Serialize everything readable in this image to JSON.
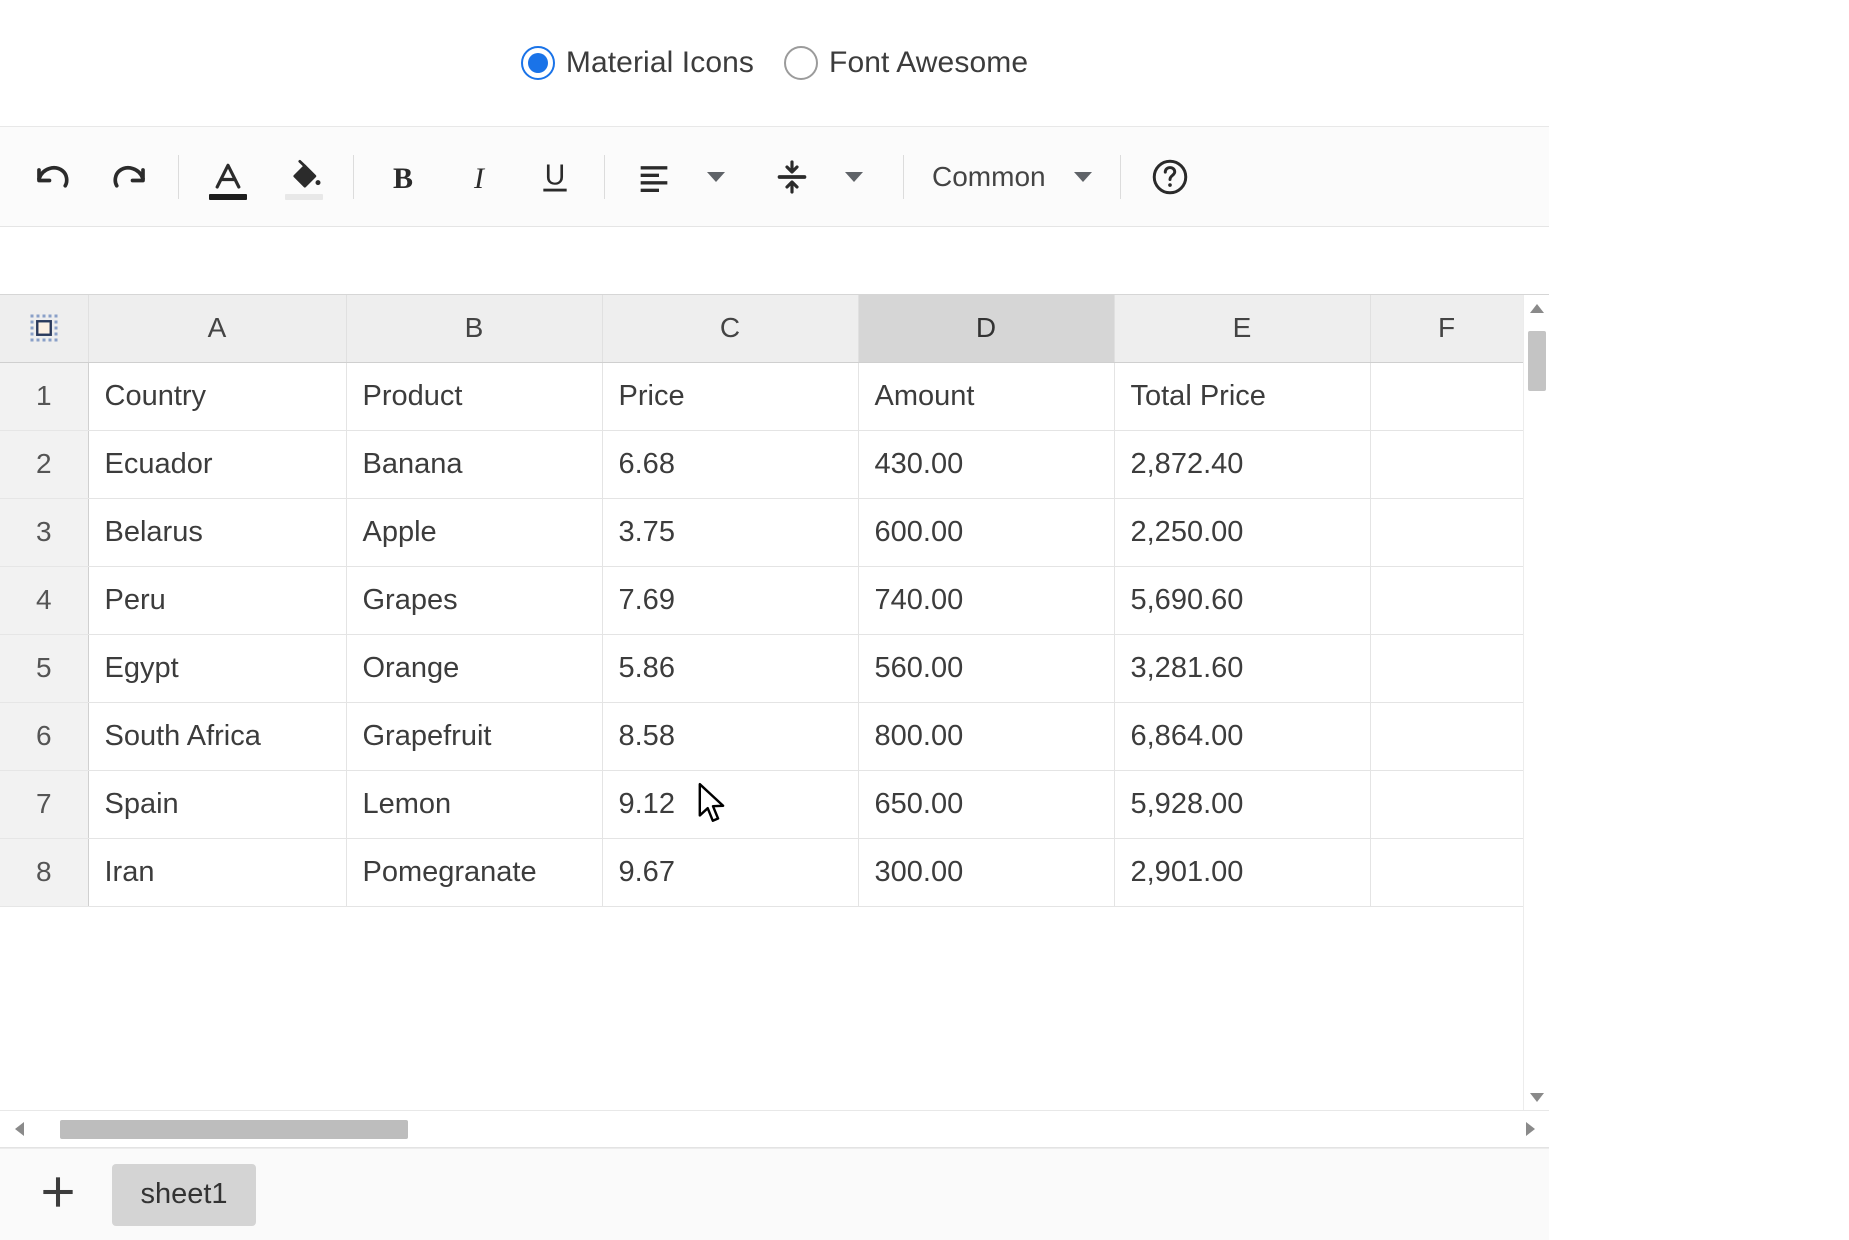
{
  "icon_set_selector": {
    "options": [
      {
        "label": "Material Icons",
        "value": "material",
        "selected": true
      },
      {
        "label": "Font Awesome",
        "value": "fontawesome",
        "selected": false
      }
    ],
    "accent_color": "#1a73e8"
  },
  "toolbar": {
    "undo": {
      "name": "undo",
      "tooltip": "Undo"
    },
    "redo": {
      "name": "redo",
      "tooltip": "Redo"
    },
    "text_color": {
      "name": "text-color",
      "glyph": "A",
      "bar_color": "#1d1d1d"
    },
    "fill_color": {
      "name": "fill-color",
      "bar_color": "#e8e8e8"
    },
    "bold": {
      "name": "bold",
      "glyph": "B"
    },
    "italic": {
      "name": "italic",
      "glyph": "I"
    },
    "underline": {
      "name": "underline",
      "glyph": "U"
    },
    "horizontal_align": {
      "name": "horizontal-align"
    },
    "vertical_align": {
      "name": "vertical-align"
    },
    "number_format": {
      "label": "Common"
    },
    "help": {
      "name": "help"
    }
  },
  "spreadsheet": {
    "column_headers": [
      "A",
      "B",
      "C",
      "D",
      "E",
      "F"
    ],
    "active_column": "D",
    "row_headers": [
      "1",
      "2",
      "3",
      "4",
      "5",
      "6",
      "7",
      "8"
    ],
    "rows": [
      {
        "num": "1",
        "a": "Country",
        "b": "Product",
        "c": "Price",
        "d": "Amount",
        "e": "Total Price",
        "f": ""
      },
      {
        "num": "2",
        "a": "Ecuador",
        "b": "Banana",
        "c": "6.68",
        "d": "430.00",
        "e": "2,872.40",
        "f": ""
      },
      {
        "num": "3",
        "a": "Belarus",
        "b": "Apple",
        "c": "3.75",
        "d": "600.00",
        "e": "2,250.00",
        "f": ""
      },
      {
        "num": "4",
        "a": "Peru",
        "b": "Grapes",
        "c": "7.69",
        "d": "740.00",
        "e": "5,690.60",
        "f": ""
      },
      {
        "num": "5",
        "a": "Egypt",
        "b": "Orange",
        "c": "5.86",
        "d": "560.00",
        "e": "3,281.60",
        "f": ""
      },
      {
        "num": "6",
        "a": "South Africa",
        "b": "Grapefruit",
        "c": "8.58",
        "d": "800.00",
        "e": "6,864.00",
        "f": ""
      },
      {
        "num": "7",
        "a": "Spain",
        "b": "Lemon",
        "c": "9.12",
        "d": "650.00",
        "e": "5,928.00",
        "f": ""
      },
      {
        "num": "8",
        "a": "Iran",
        "b": "Pomegranate",
        "c": "9.67",
        "d": "300.00",
        "e": "2,901.00",
        "f": ""
      }
    ]
  },
  "sheet_bar": {
    "add_label": "+",
    "tabs": [
      {
        "label": "sheet1",
        "active": true
      }
    ]
  },
  "colors": {
    "header_bg": "#eeeeee",
    "header_active_bg": "#d6d6d6",
    "grid_line": "#e4e4e4",
    "scroll_thumb": "#bdbdbd"
  }
}
